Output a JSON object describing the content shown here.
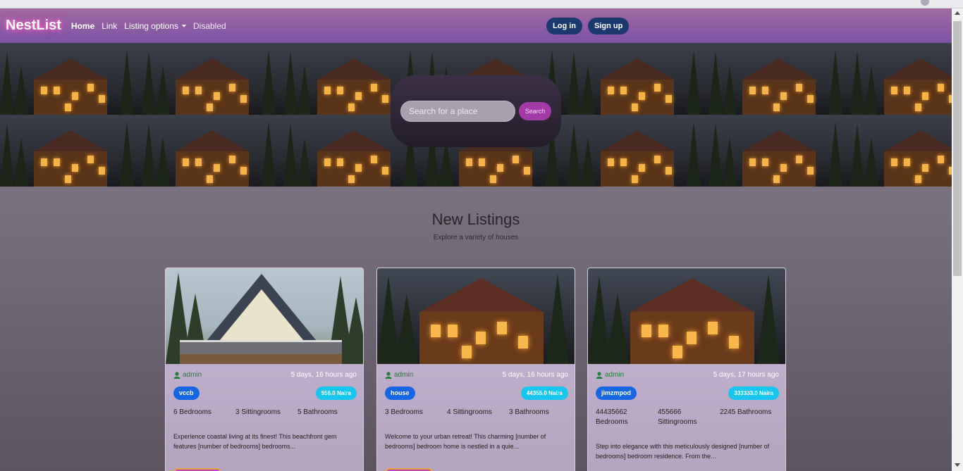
{
  "navbar": {
    "brand": "NestList",
    "links": [
      {
        "label": "Home",
        "active": true
      },
      {
        "label": "Link"
      },
      {
        "label": "Listing options",
        "dropdown": true
      },
      {
        "label": "Disabled",
        "disabled": true
      }
    ],
    "login_label": "Log in",
    "signup_label": "Sign up"
  },
  "hero": {
    "search_placeholder": "Search for a place",
    "search_label": "Search"
  },
  "listings": {
    "title": "New Listings",
    "subtitle": "Explore a variety of houses",
    "cards": [
      {
        "author": "admin",
        "posted": "5 days, 16 hours ago",
        "category": "vccb",
        "price": "556.0 Naira",
        "bedrooms": "6 Bedrooms",
        "sittingrooms": "3 Sittingrooms",
        "bathrooms": "5 Bathrooms",
        "description": "Experience coastal living at its finest! This beachfront gem features [number of bedrooms] bedrooms..."
      },
      {
        "author": "admin",
        "posted": "5 days, 16 hours ago",
        "category": "house",
        "price": "44355.0 Naira",
        "bedrooms": "3 Bedrooms",
        "sittingrooms": "4 Sittingrooms",
        "bathrooms": "3 Bathrooms",
        "description": "Welcome to your urban retreat! This charming [number of bedrooms] bedroom home is nestled in a quie..."
      },
      {
        "author": "admin",
        "posted": "5 days, 17 hours ago",
        "category": "jimzmpod",
        "price": "333333.0 Naira",
        "bedrooms": "44435662 Bedrooms",
        "sittingrooms": "455666 Sittingrooms",
        "bathrooms": "2245 Bathrooms",
        "description": "Step into elegance with this meticulously designed [number of bedrooms] bedroom residence. From the..."
      }
    ]
  },
  "colors": {
    "navbar_start": "#a26aa0",
    "navbar_end": "#7d52a6",
    "brand_glow": "#ff3fc4",
    "auth_button": "#1a3a6e",
    "search_button": "#a33ba6",
    "category_pill": "#1566e0",
    "price_pill": "#16c6ef",
    "author_text": "#1e7e3a"
  },
  "icons": {
    "author": "person-icon",
    "dropdown": "caret-down-icon"
  }
}
